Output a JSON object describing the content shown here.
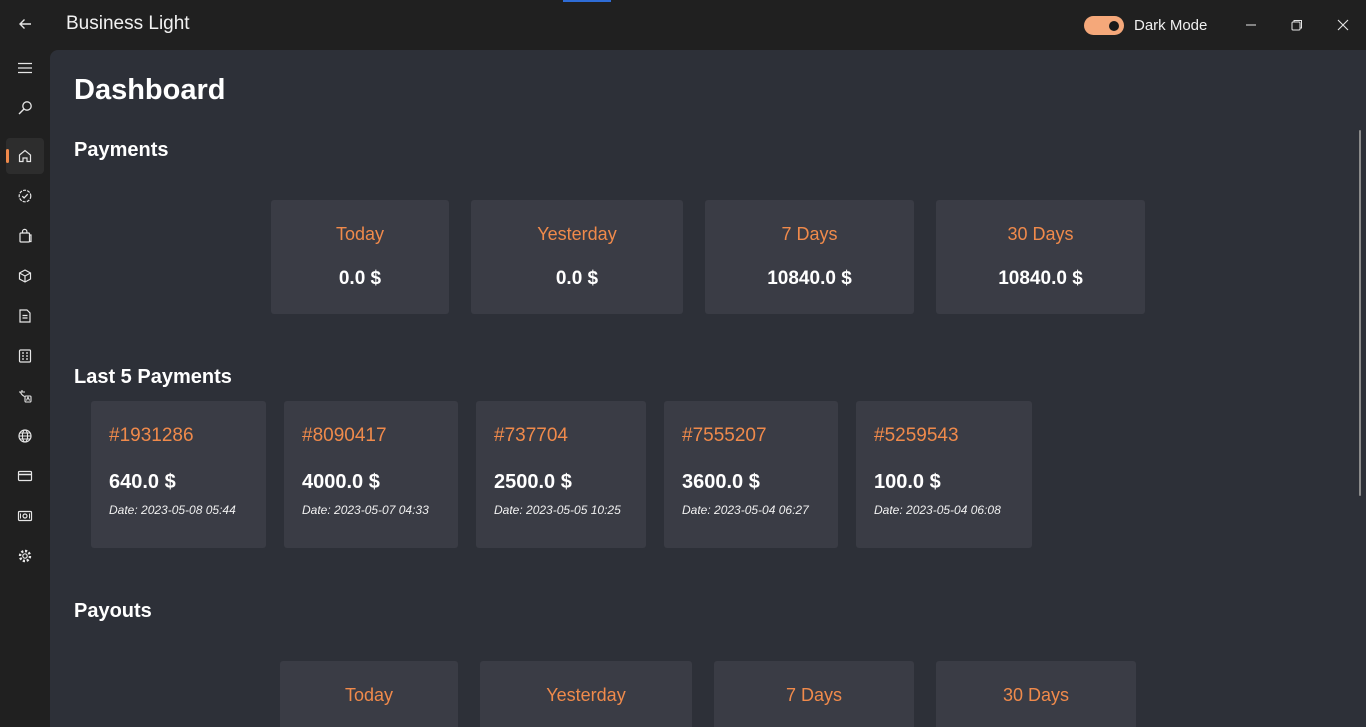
{
  "app": {
    "title": "Business Light"
  },
  "titlebar": {
    "dark_mode_label": "Dark Mode",
    "dark_mode_on": true,
    "controls": [
      "minimize-icon",
      "restore-icon",
      "close-icon"
    ]
  },
  "sidebar": {
    "items": [
      {
        "name": "menu",
        "icon": "hamburger-icon"
      },
      {
        "name": "search",
        "icon": "search-icon"
      },
      {
        "name": "home",
        "icon": "home-icon",
        "active": true
      },
      {
        "name": "badge",
        "icon": "badge-check-icon"
      },
      {
        "name": "shopping",
        "icon": "shopping-bag-icon"
      },
      {
        "name": "products",
        "icon": "box-icon"
      },
      {
        "name": "orders",
        "icon": "clipboard-icon"
      },
      {
        "name": "invoices",
        "icon": "receipt-icon"
      },
      {
        "name": "translate",
        "icon": "translate-icon"
      },
      {
        "name": "global",
        "icon": "globe-icon"
      },
      {
        "name": "cards",
        "icon": "credit-card-icon"
      },
      {
        "name": "money",
        "icon": "cash-icon"
      },
      {
        "name": "settings",
        "icon": "gear-icon"
      }
    ]
  },
  "main": {
    "title": "Dashboard",
    "payments": {
      "title": "Payments",
      "summary": [
        {
          "label": "Today",
          "value": "0.0 $"
        },
        {
          "label": "Yesterday",
          "value": "0.0 $"
        },
        {
          "label": "7 Days",
          "value": "10840.0 $"
        },
        {
          "label": "30 Days",
          "value": "10840.0 $"
        }
      ]
    },
    "last_payments": {
      "title": "Last 5 Payments",
      "items": [
        {
          "id": "#1931286",
          "amount": "640.0 $",
          "date": "Date: 2023-05-08 05:44"
        },
        {
          "id": "#8090417",
          "amount": "4000.0 $",
          "date": "Date: 2023-05-07 04:33"
        },
        {
          "id": "#737704",
          "amount": "2500.0 $",
          "date": "Date: 2023-05-05 10:25"
        },
        {
          "id": "#7555207",
          "amount": "3600.0 $",
          "date": "Date: 2023-05-04 06:27"
        },
        {
          "id": "#5259543",
          "amount": "100.0 $",
          "date": "Date: 2023-05-04 06:08"
        }
      ]
    },
    "payouts": {
      "title": "Payouts",
      "summary": [
        {
          "label": "Today"
        },
        {
          "label": "Yesterday"
        },
        {
          "label": "7 Days"
        },
        {
          "label": "30 Days"
        }
      ]
    }
  },
  "colors": {
    "accent": "#f08a4b",
    "toggle": "#f5a87a",
    "window_bg": "#202020",
    "content_bg": "#2d3038",
    "card_bg": "#3a3c45"
  }
}
